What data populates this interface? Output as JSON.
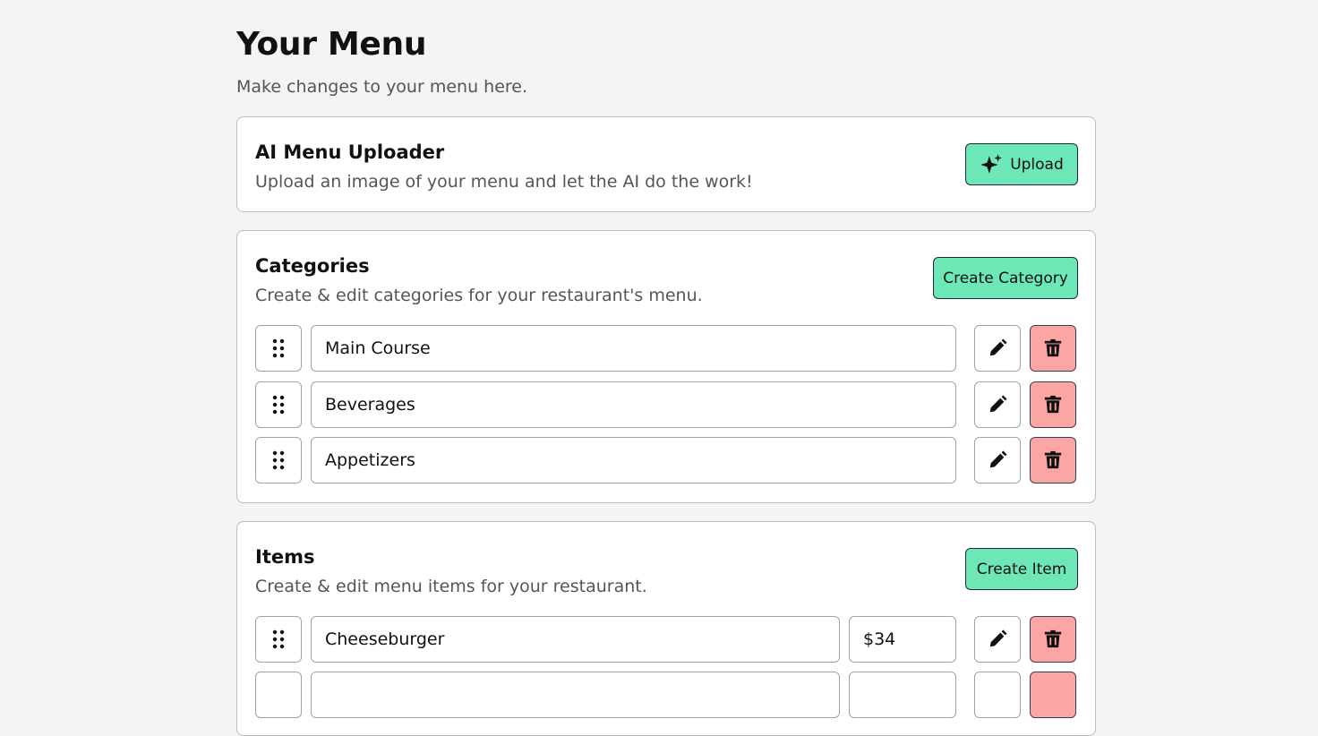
{
  "header": {
    "title": "Your Menu",
    "subtitle": "Make changes to your menu here."
  },
  "uploader": {
    "title": "AI Menu Uploader",
    "description": "Upload an image of your menu and let the AI do the work!",
    "button_label": "Upload",
    "button_icon": "sparkles-icon"
  },
  "categories": {
    "title": "Categories",
    "description": "Create & edit categories for your restaurant's menu.",
    "button_label": "Create Category",
    "items": [
      {
        "name": "Main Course"
      },
      {
        "name": "Beverages"
      },
      {
        "name": "Appetizers"
      }
    ]
  },
  "items": {
    "title": "Items",
    "description": "Create & edit menu items for your restaurant.",
    "button_label": "Create Item",
    "rows": [
      {
        "name": "Cheeseburger",
        "price": "$34"
      }
    ]
  },
  "icons": {
    "drag": "drag-handle-icon",
    "edit": "pencil-icon",
    "delete": "trash-icon"
  },
  "colors": {
    "accent": "#6ee7b7",
    "danger": "#fca5a5",
    "background": "#f4f4f4"
  }
}
